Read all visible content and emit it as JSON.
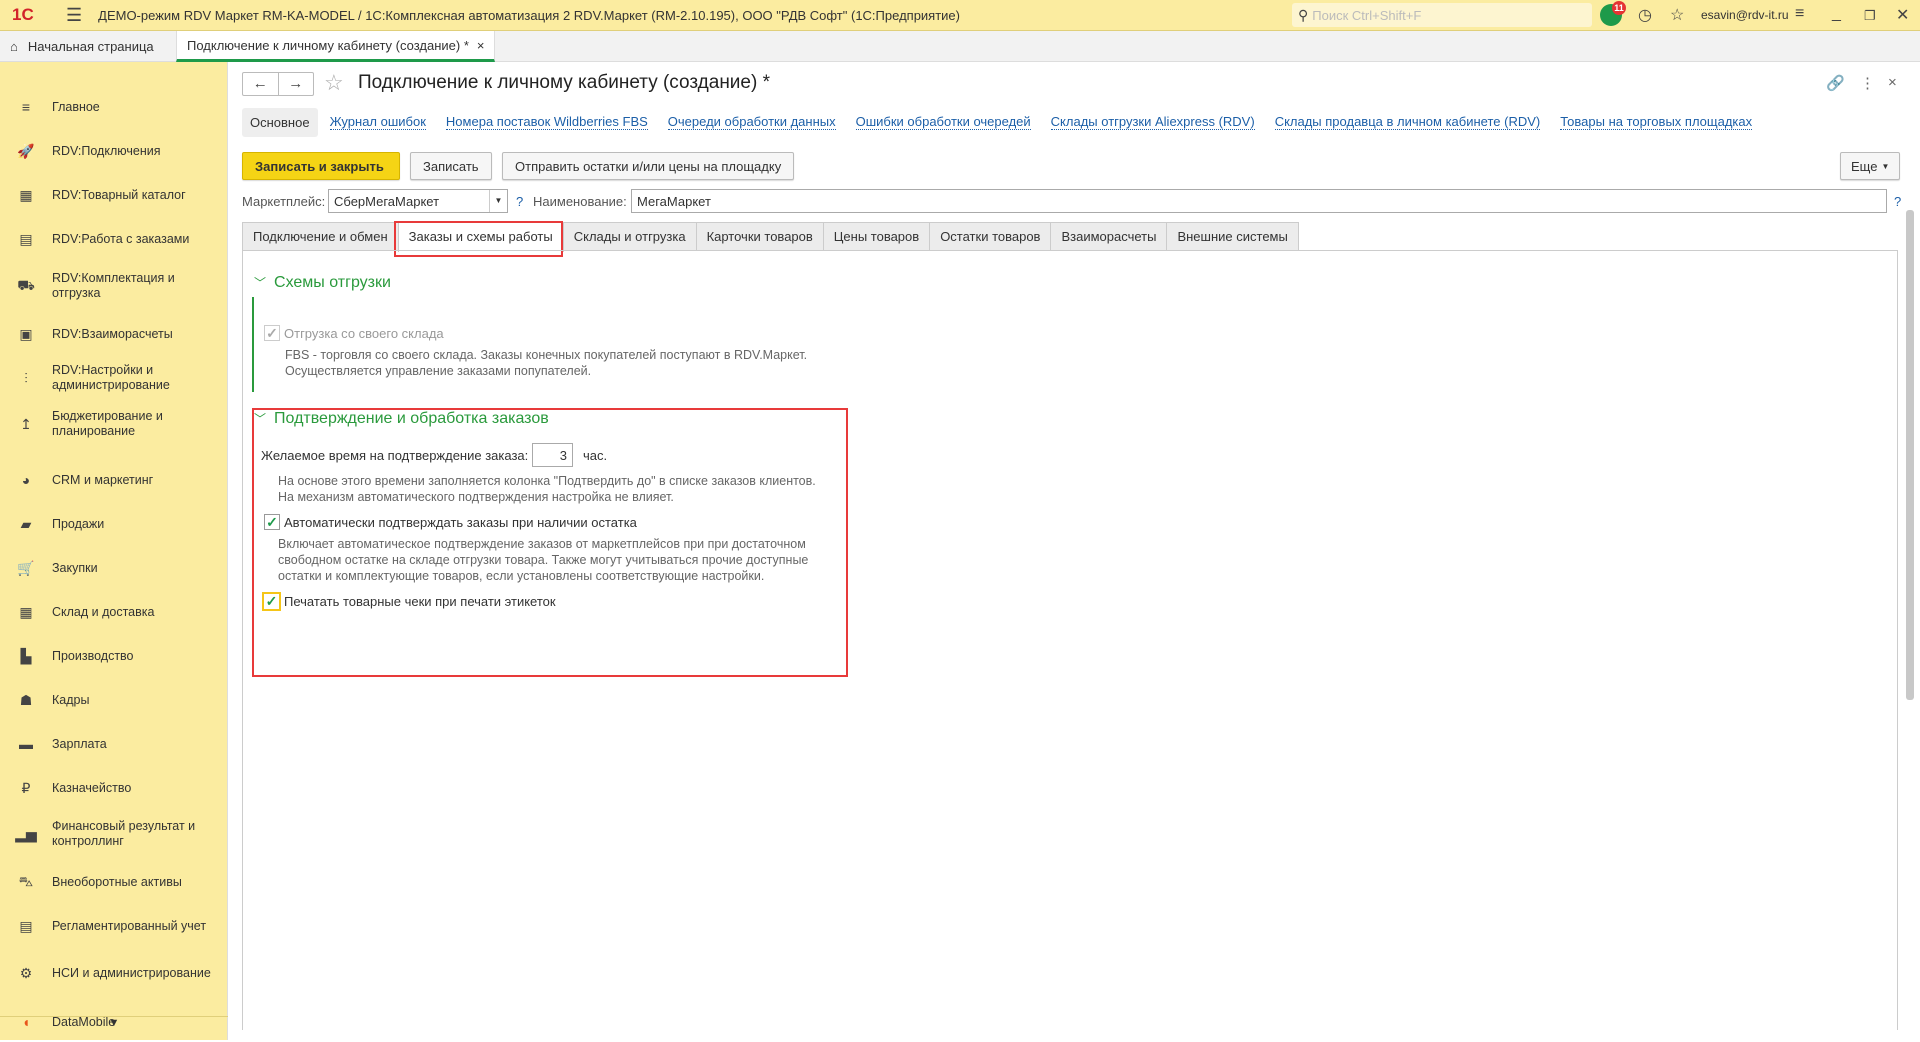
{
  "app": {
    "logo": "1С",
    "title": "ДЕМО-режим RDV Маркет RM-KA-MODEL / 1С:Комплексная автоматизация 2 RDV.Маркет (RM-2.10.195), ООО \"РДВ Софт\"  (1С:Предприятие)",
    "search_placeholder": "Поиск Ctrl+Shift+F",
    "notifications": "11",
    "user": "esavin@rdv-it.ru"
  },
  "open_tabs": [
    {
      "label": "Начальная страница"
    },
    {
      "label": "Подключение к личному кабинету (создание) *"
    }
  ],
  "sidebar": {
    "items": [
      {
        "label": "Главное",
        "icon": "≡"
      },
      {
        "label": "RDV:Подключения",
        "icon": "🚀"
      },
      {
        "label": "RDV:Товарный каталог",
        "icon": "▦"
      },
      {
        "label": "RDV:Работа с заказами",
        "icon": "▤"
      },
      {
        "label": "RDV:Комплектация и отгрузка",
        "icon": "⛟"
      },
      {
        "label": "RDV:Взаиморасчеты",
        "icon": "▣"
      },
      {
        "label": "RDV:Настройки и администрирование",
        "icon": "⫶"
      },
      {
        "label": "Бюджетирование и планирование",
        "icon": "↥"
      },
      {
        "label": "CRM и маркетинг",
        "icon": "◕"
      },
      {
        "label": "Продажи",
        "icon": "▰"
      },
      {
        "label": "Закупки",
        "icon": "🛒"
      },
      {
        "label": "Склад и доставка",
        "icon": "▦"
      },
      {
        "label": "Производство",
        "icon": "▙"
      },
      {
        "label": "Кадры",
        "icon": "☗"
      },
      {
        "label": "Зарплата",
        "icon": "▬"
      },
      {
        "label": "Казначейство",
        "icon": "₽"
      },
      {
        "label": "Финансовый результат и контроллинг",
        "icon": "▂▅"
      },
      {
        "label": "Внеоборотные активы",
        "icon": "⛍"
      },
      {
        "label": "Регламентированный учет",
        "icon": "▤"
      },
      {
        "label": "НСИ и администрирование",
        "icon": "⚙"
      },
      {
        "label": "DataMobile",
        "icon": "◖"
      }
    ]
  },
  "form": {
    "title": "Подключение к личному кабинету (создание) *",
    "nav_links": {
      "main": "Основное",
      "links": [
        "Журнал ошибок",
        "Номера поставок Wildberries FBS",
        "Очереди обработки данных",
        "Ошибки обработки очередей",
        "Склады отгрузки Aliexpress (RDV)",
        "Склады продавца в личном кабинете (RDV)",
        "Товары на торговых площадках"
      ]
    },
    "buttons": {
      "save_close": "Записать и закрыть",
      "save": "Записать",
      "send": "Отправить остатки и/или цены на площадку",
      "more": "Еще"
    },
    "marketplace_label": "Маркетплейс:",
    "marketplace_value": "СберМегаМаркет",
    "name_label": "Наименование:",
    "name_value": "МегаМаркет",
    "help": "?",
    "tabs": [
      "Подключение и обмен",
      "Заказы и схемы работы",
      "Склады и отгрузка",
      "Карточки товаров",
      "Цены товаров",
      "Остатки товаров",
      "Взаиморасчеты",
      "Внешние системы"
    ],
    "section1": {
      "title": "Схемы отгрузки",
      "checkbox_label": "Отгрузка со своего склада",
      "checked": true,
      "desc1": "FBS - торговля со своего склада. Заказы конечных покупателей поступают в RDV.Маркет.",
      "desc2": "Осуществляется управление заказами попупателей."
    },
    "section2": {
      "title": "Подтверждение и обработка заказов",
      "time_label": "Желаемое время на подтверждение заказа:",
      "time_value": "3",
      "time_unit": "час.",
      "time_desc1": "На основе этого времени заполняется колонка \"Подтвердить до\" в списке заказов клиентов.",
      "time_desc2": "На механизм автоматического подтверждения настройка не влияет.",
      "auto_label": "Автоматически подтверждать заказы при наличии остатка",
      "auto_checked": true,
      "auto_desc1": "Включает автоматическое подтверждение заказов от маркетплейсов при при достаточном",
      "auto_desc2": "свободном остатке на складе отгрузки товара. Также могут учитываться прочие доступные",
      "auto_desc3": "остатки и комплектующие товаров, если установлены соответствующие настройки.",
      "print_label": "Печатать товарные чеки при печати этикеток",
      "print_checked": true
    }
  }
}
